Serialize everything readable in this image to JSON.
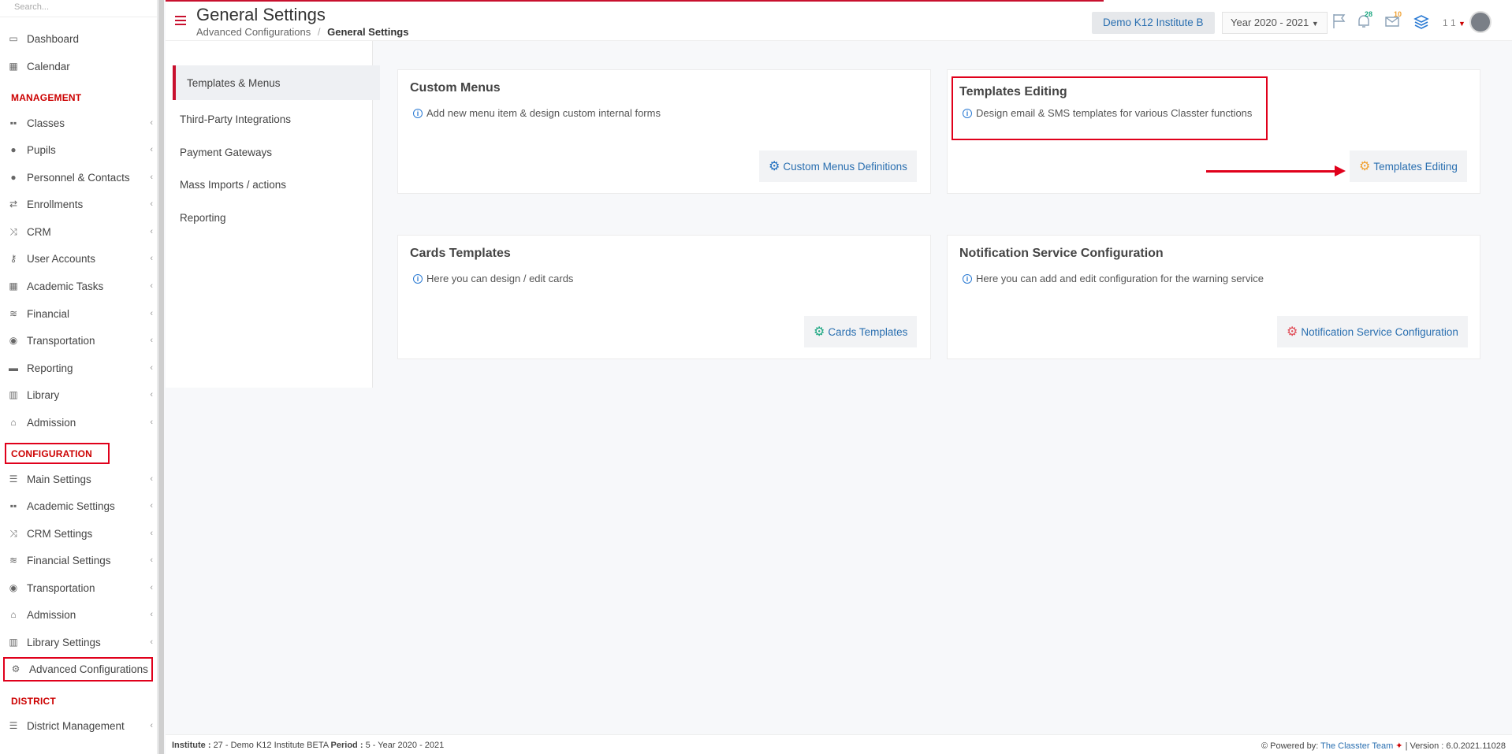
{
  "sidebar": {
    "search_placeholder": "Search...",
    "items_top": [
      {
        "label": "Dashboard",
        "icon": "laptop-icon"
      },
      {
        "label": "Calendar",
        "icon": "calendar-icon"
      }
    ],
    "management_title": "MANAGEMENT",
    "management": [
      {
        "label": "Classes",
        "icon": "classes-icon"
      },
      {
        "label": "Pupils",
        "icon": "users-icon"
      },
      {
        "label": "Personnel & Contacts",
        "icon": "user-icon"
      },
      {
        "label": "Enrollments",
        "icon": "exchange-icon"
      },
      {
        "label": "CRM",
        "icon": "shuffle-icon"
      },
      {
        "label": "User Accounts",
        "icon": "key-icon"
      },
      {
        "label": "Academic Tasks",
        "icon": "grid-icon"
      },
      {
        "label": "Financial",
        "icon": "coins-icon"
      },
      {
        "label": "Transportation",
        "icon": "bus-icon"
      },
      {
        "label": "Reporting",
        "icon": "print-icon"
      },
      {
        "label": "Library",
        "icon": "books-icon"
      },
      {
        "label": "Admission",
        "icon": "institution-icon"
      }
    ],
    "configuration_title": "CONFIGURATION",
    "configuration": [
      {
        "label": "Main Settings",
        "icon": "sliders-icon"
      },
      {
        "label": "Academic Settings",
        "icon": "classes-icon"
      },
      {
        "label": "CRM Settings",
        "icon": "shuffle-icon"
      },
      {
        "label": "Financial Settings",
        "icon": "coins-icon"
      },
      {
        "label": "Transportation",
        "icon": "bus-icon"
      },
      {
        "label": "Admission",
        "icon": "institution-icon"
      },
      {
        "label": "Library Settings",
        "icon": "books-icon"
      },
      {
        "label": "Advanced Configurations",
        "icon": "gears-icon"
      }
    ],
    "district_title": "DISTRICT",
    "district": [
      {
        "label": "District Management",
        "icon": "list-icon"
      }
    ]
  },
  "header": {
    "title": "General Settings",
    "breadcrumb_parent": "Advanced Configurations",
    "breadcrumb_sep": "/",
    "breadcrumb_current": "General Settings",
    "institute": "Demo K12 Institute B",
    "year": "Year 2020 - 2021",
    "notifications_count": "28",
    "messages_count": "10",
    "user_label": "1 1"
  },
  "submenu": [
    {
      "label": "Templates & Menus"
    },
    {
      "label": "Third-Party Integrations"
    },
    {
      "label": "Payment Gateways"
    },
    {
      "label": "Mass Imports / actions"
    },
    {
      "label": "Reporting"
    }
  ],
  "cards": [
    {
      "title": "Custom Menus",
      "desc": "Add new menu item & design custom internal forms",
      "button": "Custom Menus Definitions",
      "icon_color": "#1f6fbf"
    },
    {
      "title": "Templates Editing",
      "desc": "Design email & SMS templates for various Classter functions",
      "button": "Templates Editing",
      "icon_color": "#f0a030"
    },
    {
      "title": "Cards Templates",
      "desc": "Here you can design / edit cards",
      "button": "Cards Templates",
      "icon_color": "#1aa680"
    },
    {
      "title": "Notification Service Configuration",
      "desc": "Here you can add and edit configuration for the warning service",
      "button": "Notification Service Configuration",
      "icon_color": "#e04a55"
    }
  ],
  "footer": {
    "institute_label": "Institute :",
    "institute_value": "27 - Demo K12 Institute BETA",
    "period_label": "Period :",
    "period_value": "5 - Year 2020 - 2021",
    "powered_label": "Powered by:",
    "powered_link": "The Classter Team",
    "version": "| Version : 6.0.2021.11028"
  }
}
